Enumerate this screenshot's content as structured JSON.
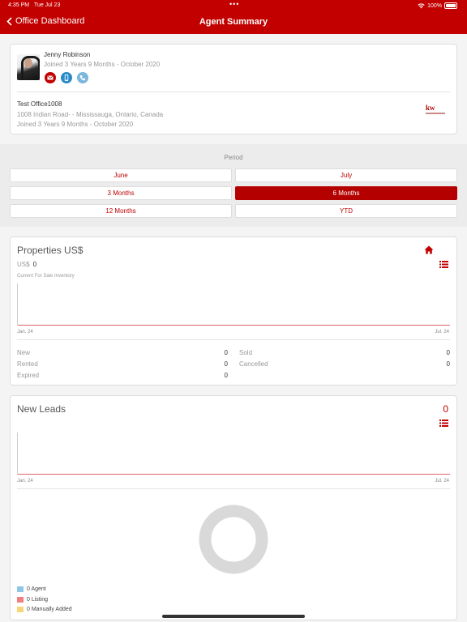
{
  "status_bar": {
    "time": "4:35 PM",
    "date": "Tue Jul 23",
    "battery": "100%",
    "dots": "•••"
  },
  "nav": {
    "back_label": "Office Dashboard",
    "title": "Agent Summary"
  },
  "agent": {
    "name": "Jenny Robinson",
    "joined": "Joined 3 Years 9 Months - October 2020",
    "office_name": "Test Office1008",
    "office_address": "1008 Indian Road- - Mississauga,  Ontario,  Canada",
    "office_joined": "Joined 3 Years 9 Months - October 2020",
    "logo_text": "kw"
  },
  "period": {
    "label": "Period",
    "options": [
      "June",
      "July",
      "3 Months",
      "6 Months",
      "12 Months",
      "YTD"
    ],
    "selected": "6 Months"
  },
  "properties": {
    "title": "Properties  US$",
    "currency": "US$",
    "value": "0",
    "inventory_label": "Current For Sale Inventory",
    "x_start": "Jan. 24",
    "x_end": "Jul. 24",
    "stats": [
      {
        "label": "New",
        "value": "0"
      },
      {
        "label": "Sold",
        "value": "0"
      },
      {
        "label": "Rented",
        "value": "0"
      },
      {
        "label": "Cancelled",
        "value": "0"
      },
      {
        "label": "Expired",
        "value": "0"
      }
    ]
  },
  "leads": {
    "title": "New Leads",
    "count": "0",
    "x_start": "Jan. 24",
    "x_end": "Jul. 24",
    "legend": [
      {
        "label": "0 Agent",
        "color": "#8ec8e6"
      },
      {
        "label": "0 Listing",
        "color": "#f08080"
      },
      {
        "label": "0 Manually Added",
        "color": "#f5d77a"
      }
    ]
  },
  "colors": {
    "brand": "#c20000",
    "donut_empty": "#d9d9d9"
  }
}
